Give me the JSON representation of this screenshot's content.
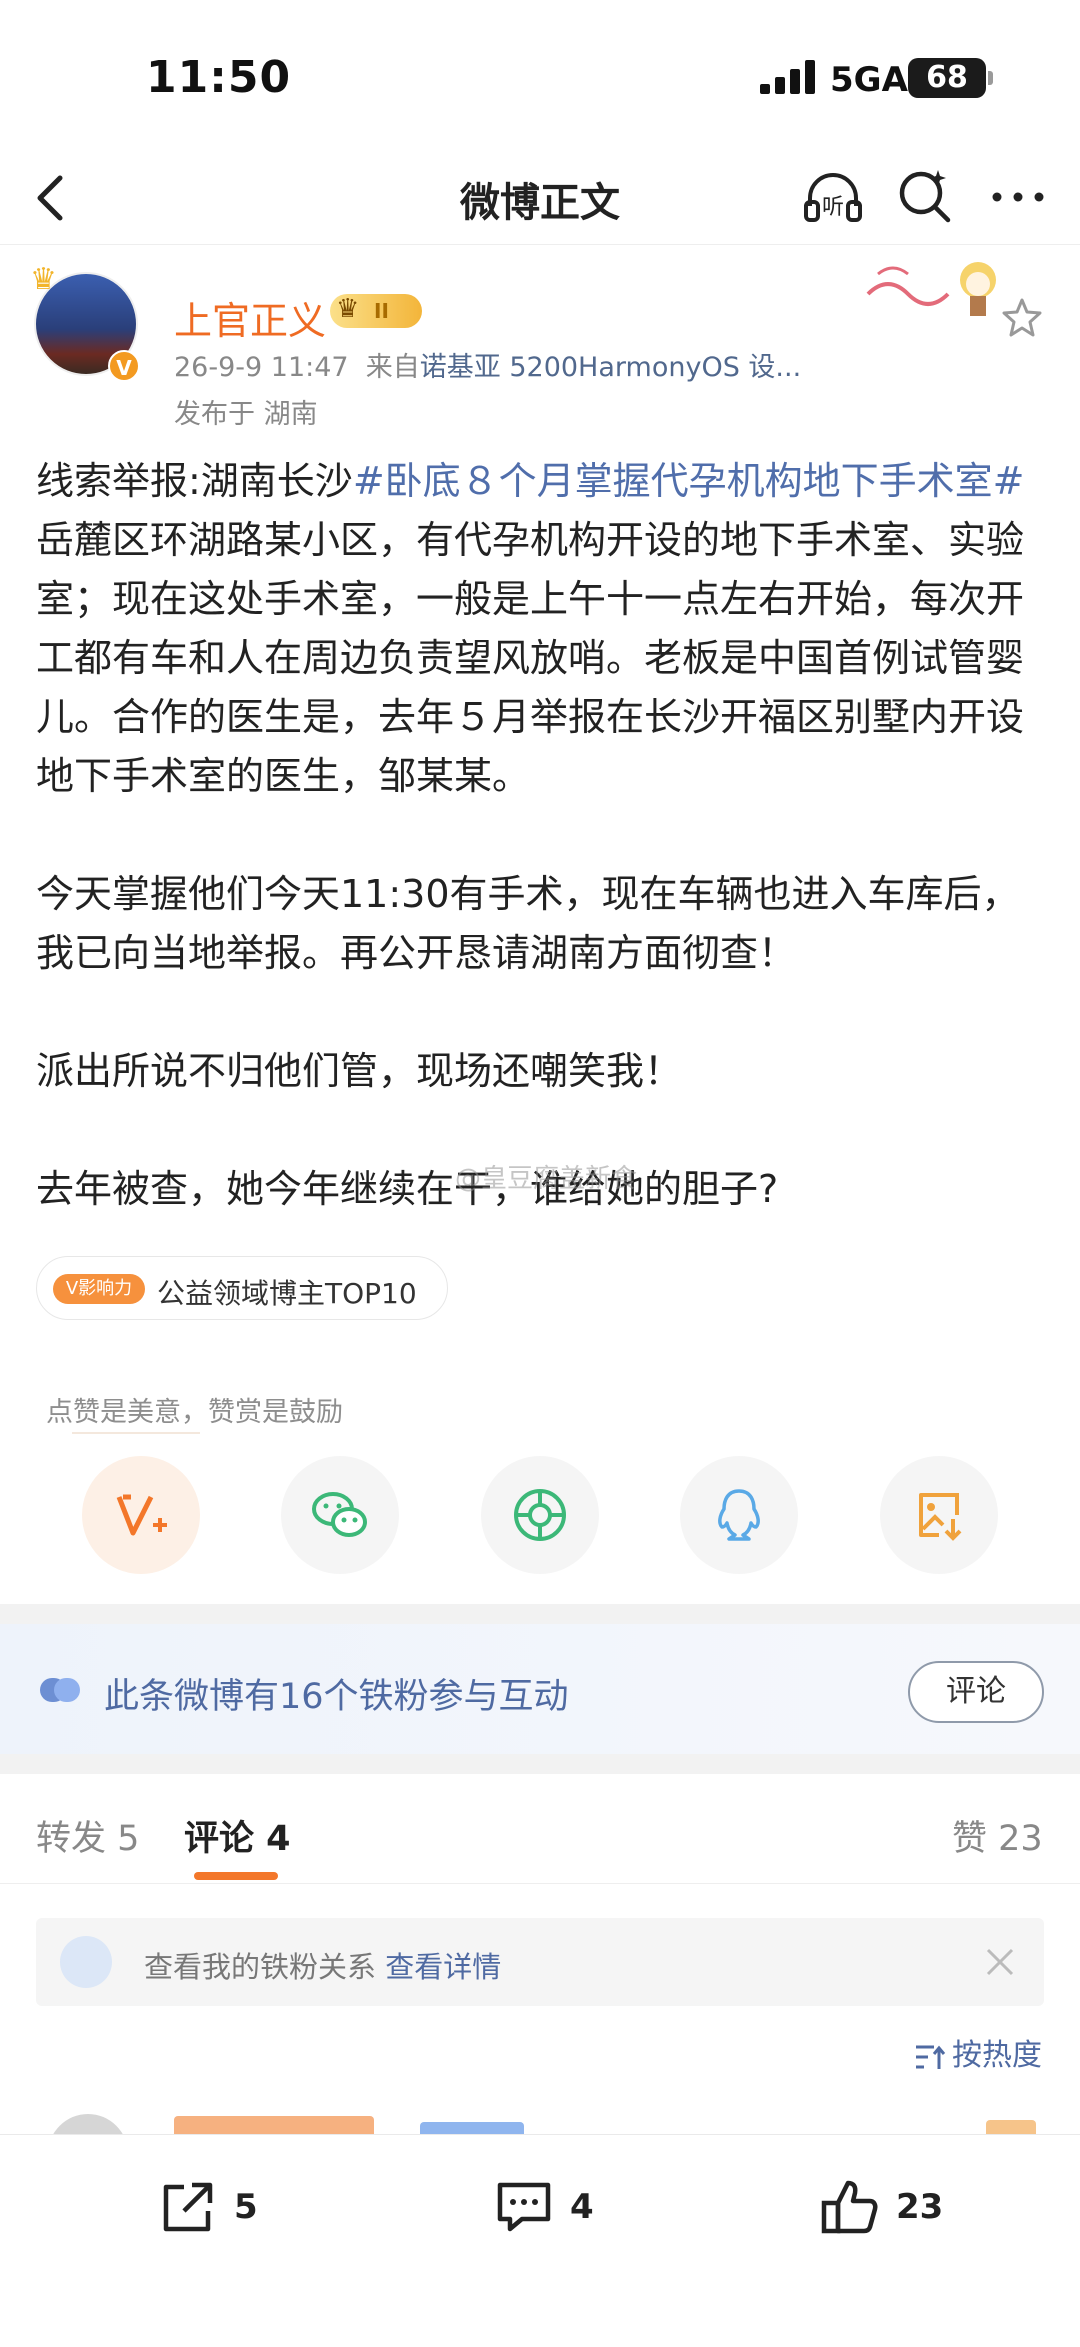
{
  "status_bar": {
    "time": "11:50",
    "network": "5GA",
    "battery": "68"
  },
  "nav": {
    "title": "微博正文",
    "listen_label": "听"
  },
  "author": {
    "name": "上官正义",
    "level": "II",
    "date": "26-9-9 11:47",
    "source_prefix": "来自",
    "device": "诺基亚 5200HarmonyOS 设...",
    "location": "发布于 湖南"
  },
  "post": {
    "p1_a": "线索举报:湖南长沙",
    "p1_tag": "#卧底８个月掌握代孕机构地下手术室#",
    "p1_b": " 岳麓区环湖路某小区，有代孕机构开设的地下手术室、实验室；现在这处手术室，一般是上午十一点左右开始，每次开工都有车和人在周边负责望风放哨。老板是中国首例试管婴儿。合作的医生是，去年５月举报在长沙开福区别墅内开设地下手术室的医生，邹某某。",
    "p2": "今天掌握他们今天11:30有手术，现在车辆也进入车库后，我已向当地举报。再公开恳请湖南方面彻查！",
    "p3": "派出所说不归他们管，现场还嘲笑我！",
    "p4": "去年被查，她今年继续在干，谁给她的胆子?"
  },
  "watermark": "@皇豆腐盖新食",
  "influence": {
    "badge": "V影响力",
    "text": "公益领域博主TOP10"
  },
  "tip": "点赞是美意，赞赏是鼓励",
  "fans": {
    "text": "此条微博有16个铁粉参与互动",
    "button": "评论"
  },
  "tabs": {
    "repost": "转发 5",
    "comment": "评论 4",
    "like": "赞 23"
  },
  "relation": {
    "text": "查看我的铁粉关系 ",
    "link": "查看详情"
  },
  "sort": {
    "label": "按热度"
  },
  "bottom": {
    "repost_count": "5",
    "comment_count": "4",
    "like_count": "23"
  },
  "colors": {
    "accent": "#f3772a",
    "link": "#506eab",
    "name": "#ef6b23"
  }
}
